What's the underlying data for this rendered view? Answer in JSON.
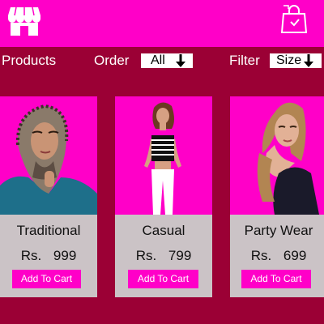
{
  "colors": {
    "primary": "#ff00c8",
    "background": "#9b0035",
    "card": "#cbc3c6"
  },
  "header": {
    "logo_icon": "storefront-icon",
    "bag_icon": "shopping-bag-icon"
  },
  "controls": {
    "products_label": "Products",
    "order_label": "Order",
    "order_value": "All",
    "filter_label": "Filter",
    "filter_value": "Size"
  },
  "products": [
    {
      "title": "Traditional",
      "price": "Rs.  999",
      "button": "Add To Cart"
    },
    {
      "title": "Casual",
      "price": "Rs.  799",
      "button": "Add To Cart"
    },
    {
      "title": "Party Wear",
      "price": "Rs.  699",
      "button": "Add To Cart"
    }
  ]
}
